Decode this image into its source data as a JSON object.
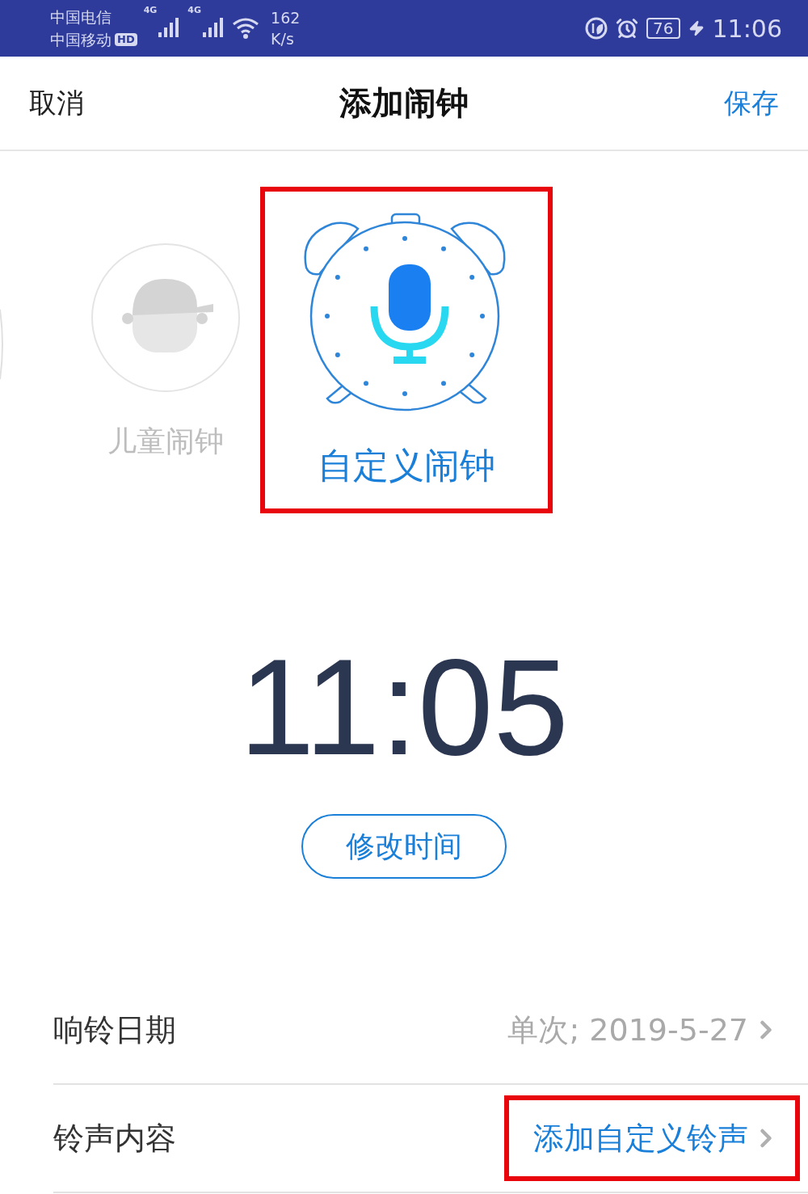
{
  "status_bar": {
    "carriers": [
      "中国电信",
      "中国移动"
    ],
    "hd_badge": "HD",
    "network_labels": [
      "4G",
      "4G"
    ],
    "speed": "162",
    "speed_unit": "K/s",
    "battery": "76",
    "time": "11:06"
  },
  "header": {
    "cancel": "取消",
    "title": "添加闹钟",
    "save": "保存"
  },
  "alarm_types": [
    {
      "kind": "kid",
      "label": "儿童闹钟",
      "selected": false,
      "highlighted": false
    },
    {
      "kind": "custom",
      "label": "自定义闹钟",
      "selected": true,
      "highlighted": true
    }
  ],
  "time": "11:05",
  "change_time_button": "修改时间",
  "settings": [
    {
      "label": "响铃日期",
      "value": "单次; 2019-5-27",
      "kind": "info",
      "highlighted": false
    },
    {
      "label": "铃声内容",
      "value": "添加自定义铃声",
      "kind": "link",
      "highlighted": true
    }
  ]
}
